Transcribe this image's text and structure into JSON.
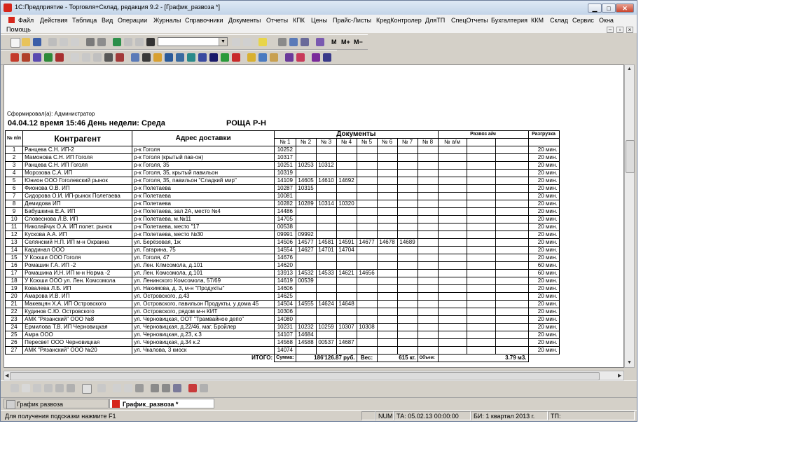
{
  "window": {
    "title": "1С:Предприятие - Торговля+Склад, редакция 9.2 - [График_развоза  *]",
    "min_label": "▁",
    "max_label": "□",
    "close_label": "✕"
  },
  "menu": [
    "Файл",
    "Действия",
    "Таблица",
    "Вид",
    "Операции",
    "Журналы",
    "Справочники",
    "Документы",
    "Отчеты",
    "КПК",
    "Цены",
    "Прайс-Листы",
    "КредКонтролер",
    "ДляТП",
    "СпецОтчеты",
    "Бухгалтерия",
    "ККМ",
    "Склад",
    "Сервис",
    "Окна",
    "Помощь"
  ],
  "toolbar": {
    "m": "M",
    "mplus": "M+",
    "mminus": "M−"
  },
  "report": {
    "formed_by": "Сформировал(а): Администратор",
    "date_line": "04.04.12 время 15:46 День недели: Среда",
    "route": "РОЩА Р-Н",
    "head": {
      "num": "№ п/п",
      "contr": "Контрагент",
      "addr": "Адрес доставки",
      "docs": "Документы",
      "doc_cols": [
        "№ 1",
        "№ 2",
        "№ 3",
        "№ 4",
        "№ 5",
        "№ 6",
        "№ 7",
        "№ 8"
      ],
      "razvoz": "Развоз а/м",
      "razvoz_sub": "№ а/м",
      "unload": "Разгрузка"
    },
    "rows": [
      {
        "n": "1",
        "c": "Ранцева С.Н. ИП-2",
        "a": "р-к Гоголя",
        "d": [
          "10252",
          "",
          "",
          "",
          "",
          "",
          "",
          ""
        ],
        "u": "20 мин."
      },
      {
        "n": "2",
        "c": "Мамонова С.Н. ИП Гоголя",
        "a": "р-к Гоголя (крытый пав-он)",
        "d": [
          "10317",
          "",
          "",
          "",
          "",
          "",
          "",
          ""
        ],
        "u": "20 мин."
      },
      {
        "n": "3",
        "c": "Ранцева С.Н. ИП Гоголя",
        "a": "р-к Гоголя, 35",
        "d": [
          "10251",
          "10253",
          "10312",
          "",
          "",
          "",
          "",
          ""
        ],
        "u": "20 мин."
      },
      {
        "n": "4",
        "c": "Морозова С.А. ИП",
        "a": "р-к Гоголя, 35, крытый павильон",
        "d": [
          "10319",
          "",
          "",
          "",
          "",
          "",
          "",
          ""
        ],
        "u": "20 мин."
      },
      {
        "n": "5",
        "c": "Юнион ООО Гоголевский рынок",
        "a": "р-к Гоголя, 35, павильон \"Сладкий мир\"",
        "d": [
          "14109",
          "14605",
          "14610",
          "14692",
          "",
          "",
          "",
          ""
        ],
        "u": "20 мин."
      },
      {
        "n": "6",
        "c": "Фионова О.В. ИП",
        "a": "р-к Полетаева",
        "d": [
          "10287",
          "10315",
          "",
          "",
          "",
          "",
          "",
          ""
        ],
        "u": "20 мин."
      },
      {
        "n": "7",
        "c": "Сидорова О.И. ИП-рынок Полетаева",
        "a": "р-к Полетаева",
        "d": [
          "10081",
          "",
          "",
          "",
          "",
          "",
          "",
          ""
        ],
        "u": "20 мин."
      },
      {
        "n": "8",
        "c": "Демидова ИП",
        "a": "р-к Полетаева",
        "d": [
          "10282",
          "10289",
          "10314",
          "10320",
          "",
          "",
          "",
          ""
        ],
        "u": "20 мин."
      },
      {
        "n": "9",
        "c": "Бабушкина Е.А. ИП",
        "a": "р-к Полетаева, зал 2А, место №4",
        "d": [
          "14486",
          "",
          "",
          "",
          "",
          "",
          "",
          ""
        ],
        "u": "20 мин."
      },
      {
        "n": "10",
        "c": "Словеснова Л.В. ИП",
        "a": "р-к Полетаева, м.№11",
        "d": [
          "14705",
          "",
          "",
          "",
          "",
          "",
          "",
          ""
        ],
        "u": "20 мин."
      },
      {
        "n": "11",
        "c": "Николайчук О.А. ИП полет. рынок",
        "a": "р-к Полетаева, место \"17",
        "d": [
          "00538",
          "",
          "",
          "",
          "",
          "",
          "",
          ""
        ],
        "u": "20 мин."
      },
      {
        "n": "12",
        "c": "Кускова А.А. ИП",
        "a": "р-к Полетаева, место №30",
        "d": [
          "09991",
          "09992",
          "",
          "",
          "",
          "",
          "",
          ""
        ],
        "u": "20 мин."
      },
      {
        "n": "13",
        "c": "Селянский Н.П. ИП м-н Окраина",
        "a": "ул. Берёзовая, 1ж",
        "d": [
          "14506",
          "14577",
          "14581",
          "14591",
          "14677",
          "14678",
          "14689",
          ""
        ],
        "u": "20 мин."
      },
      {
        "n": "14",
        "c": "Кардинал ООО",
        "a": "ул. Гагарина, 75",
        "d": [
          "14554",
          "14627",
          "14701",
          "14704",
          "",
          "",
          "",
          ""
        ],
        "u": "20 мин."
      },
      {
        "n": "15",
        "c": "У Ксюши ООО Гоголя",
        "a": "ул. Гоголя, 47",
        "d": [
          "14676",
          "",
          "",
          "",
          "",
          "",
          "",
          ""
        ],
        "u": "20 мин."
      },
      {
        "n": "16",
        "c": "Ромашин Г.А. ИП -2",
        "a": "ул. Лен. Клмсомола, д.101",
        "d": [
          "14620",
          "",
          "",
          "",
          "",
          "",
          "",
          ""
        ],
        "u": "60 мин."
      },
      {
        "n": "17",
        "c": "Ромашина И.Н. ИП м-н Норма -2",
        "a": "ул. Лен. Комсомола, д.101",
        "d": [
          "13913",
          "14532",
          "14533",
          "14621",
          "14656",
          "",
          "",
          ""
        ],
        "u": "60 мин."
      },
      {
        "n": "18",
        "c": "У Ксюши ООО ул. Лен. Комсомола",
        "a": "ул. Ленинского Комсомола, 57/69",
        "d": [
          "14619",
          "00539",
          "",
          "",
          "",
          "",
          "",
          ""
        ],
        "u": "20 мин."
      },
      {
        "n": "19",
        "c": "Ковалева Л.Б. ИП",
        "a": "ул. Нахимова, д. 3, м-н \"Продукты\"",
        "d": [
          "14606",
          "",
          "",
          "",
          "",
          "",
          "",
          ""
        ],
        "u": "20 мин."
      },
      {
        "n": "20",
        "c": "Амарова И.В. ИП",
        "a": "ул. Островского, д.43",
        "d": [
          "14625",
          "",
          "",
          "",
          "",
          "",
          "",
          ""
        ],
        "u": "20 мин."
      },
      {
        "n": "21",
        "c": "Макевцян Х.А. ИП Островского",
        "a": "ул. Островского, павильон Продукты, у дома 45",
        "d": [
          "14504",
          "14555",
          "14624",
          "14648",
          "",
          "",
          "",
          ""
        ],
        "u": "20 мин."
      },
      {
        "n": "22",
        "c": "Кудинов С.Ю.  Островского",
        "a": "ул. Островского, рядом м-н КИТ",
        "d": [
          "10306",
          "",
          "",
          "",
          "",
          "",
          "",
          ""
        ],
        "u": "20 мин."
      },
      {
        "n": "23",
        "c": "АМК \"Рязанский\" ООО №8",
        "a": "ул. Черновицкая, ООТ \"Трамвайное депо\"",
        "d": [
          "14080",
          "",
          "",
          "",
          "",
          "",
          "",
          ""
        ],
        "u": "20 мин."
      },
      {
        "n": "24",
        "c": "Ермилова Т.В. ИП Черновицкая",
        "a": "ул. Черновицкая, д.22/46, маг. Бройлер",
        "d": [
          "10231",
          "10232",
          "10259",
          "10307",
          "10308",
          "",
          "",
          ""
        ],
        "u": "20 мин."
      },
      {
        "n": "25",
        "c": "Амра ООО",
        "a": "ул. Черновицкая, д.23, к.3",
        "d": [
          "14107",
          "14684",
          "",
          "",
          "",
          "",
          "",
          ""
        ],
        "u": "20 мин."
      },
      {
        "n": "26",
        "c": "Пересвет ООО Черновицкая",
        "a": "ул. Черновицкая, д.34 к.2",
        "d": [
          "14568",
          "14588",
          "00537",
          "14687",
          "",
          "",
          "",
          ""
        ],
        "u": "20 мин."
      },
      {
        "n": "27",
        "c": "АМК \"Рязанский\" ООО №20",
        "a": "ул. Чкалова, 3 киоск",
        "d": [
          "14074",
          "",
          "",
          "",
          "",
          "",
          "",
          ""
        ],
        "u": "20 мин."
      }
    ],
    "totals": {
      "label": "ИТОГО:",
      "sum_label": "Сумма:",
      "sum": "186'126.87 руб.",
      "weight_label": "Вес:",
      "weight": "615 кг.",
      "volume_label": "Объем:",
      "volume": "3.79 м3."
    }
  },
  "tabs": [
    "График развоза",
    "График_развоза  *"
  ],
  "status": {
    "hint": "Для получения подсказки нажмите F1",
    "num": "NUM",
    "ta": "ТА: 05.02.13  00:00:00",
    "bi": "БИ: 1 квартал 2013 г.",
    "tp": "ТП:"
  }
}
